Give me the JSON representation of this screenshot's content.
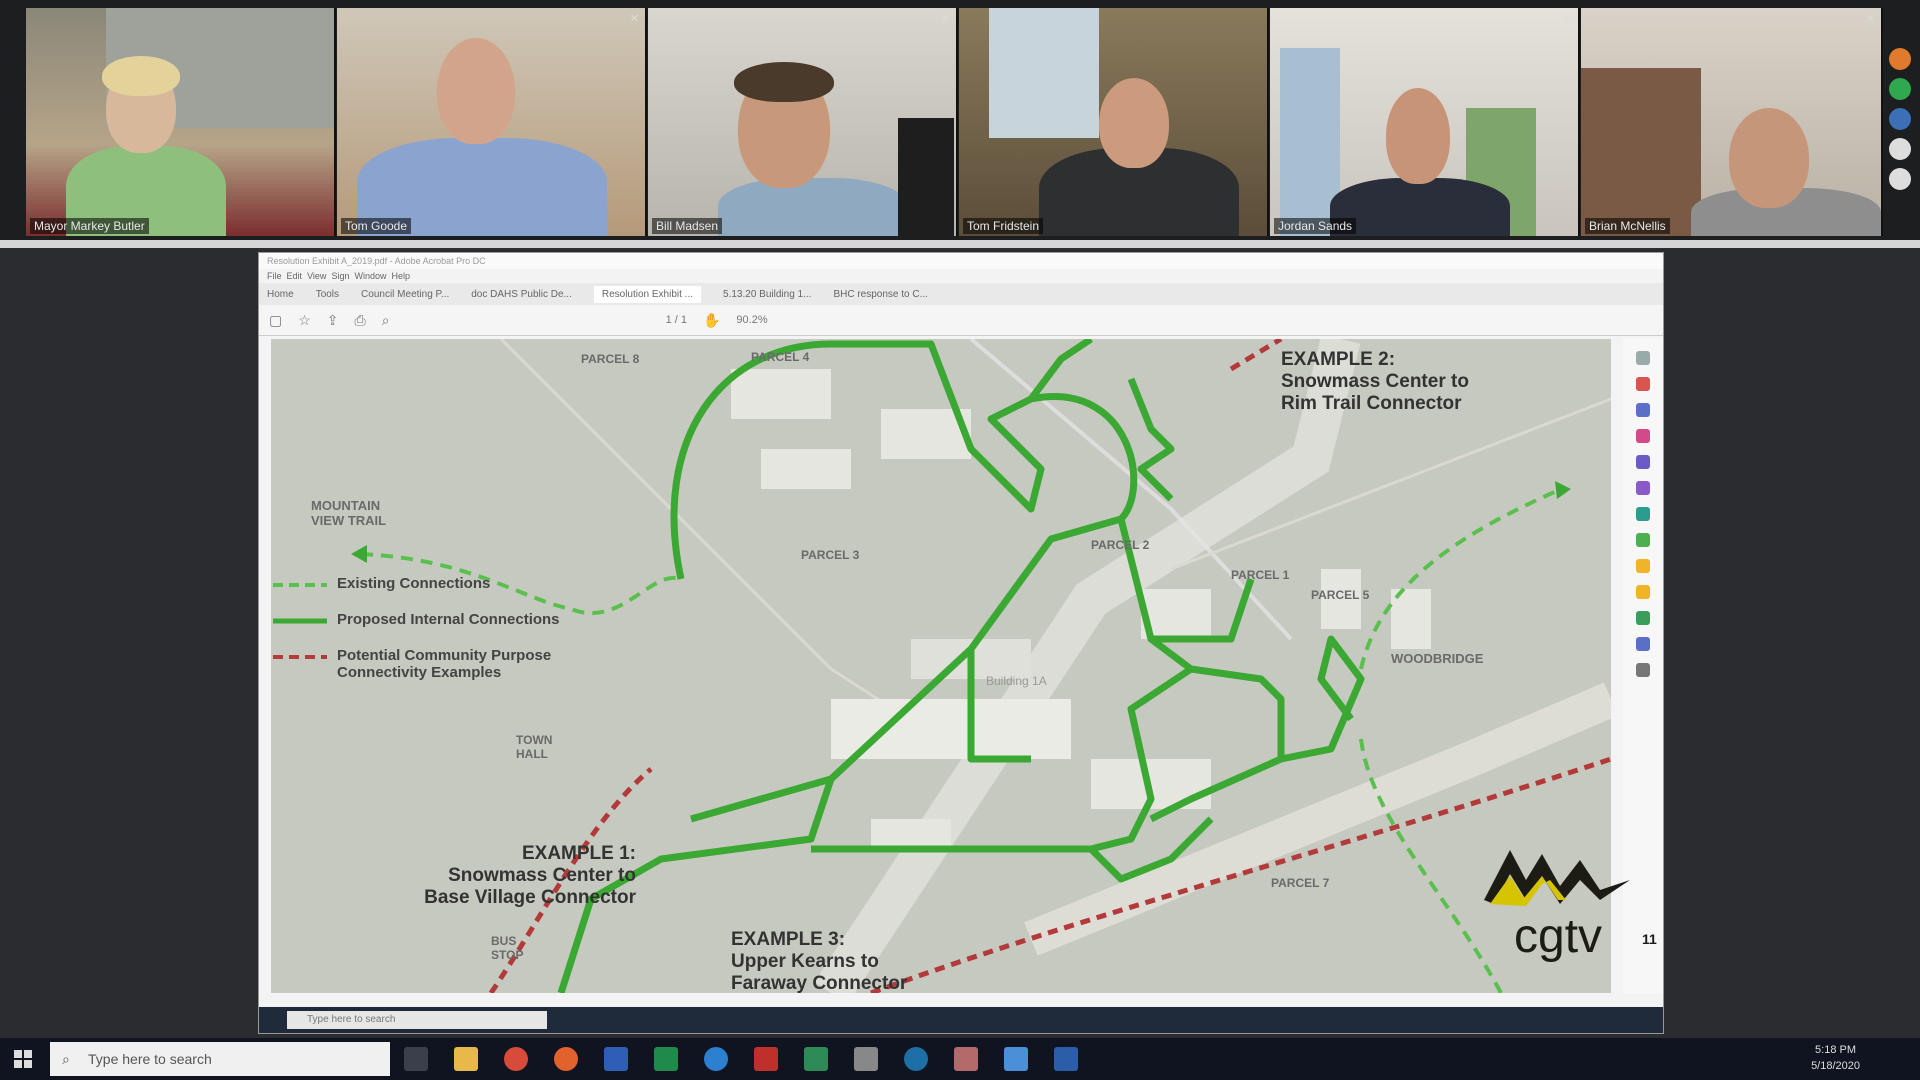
{
  "participants": [
    {
      "name": "Mayor Markey Butler"
    },
    {
      "name": "Tom Goode"
    },
    {
      "name": "Bill Madsen"
    },
    {
      "name": "Tom Fridstein"
    },
    {
      "name": "Jordan Sands"
    },
    {
      "name": "Brian McNellis"
    }
  ],
  "screen_share": {
    "window_title": "Resolution Exhibit A_2019.pdf - Adobe Acrobat Pro DC",
    "menu": [
      "File",
      "Edit",
      "View",
      "Sign",
      "Window",
      "Help"
    ],
    "tabs": [
      "Home",
      "Tools",
      "Council Meeting P...",
      "doc DAHS Public De...",
      "Resolution Exhibit ...",
      "5.13.20 Building 1...",
      "BHC response to C..."
    ],
    "page_indicator": "1 / 1",
    "zoom": "90.2%"
  },
  "map": {
    "example_2": {
      "line1": "EXAMPLE 2:",
      "line2": "Snowmass Center to",
      "line3": "Rim Trail Connector"
    },
    "example_1": {
      "line1": "EXAMPLE 1:",
      "line2": "Snowmass Center to",
      "line3": "Base Village Connector"
    },
    "example_3": {
      "line1": "EXAMPLE 3:",
      "line2": "Upper Kearns to",
      "line3": "Faraway Connector"
    },
    "mountain_view": {
      "line1": "MOUNTAIN",
      "line2": "VIEW TRAIL"
    },
    "town_hall": {
      "line1": "TOWN",
      "line2": "HALL"
    },
    "bus_stop": {
      "line1": "BUS",
      "line2": "STOP"
    },
    "woodbridge": "WOODBRIDGE",
    "parcels": [
      "PARCEL 8",
      "PARCEL 4",
      "PARCEL 3",
      "PARCEL 2",
      "PARCEL 1",
      "PARCEL 5",
      "PARCEL 7"
    ],
    "building_1a": "Building 1A",
    "legend": {
      "existing": "Existing Connections",
      "proposed": "Proposed Internal Connections",
      "potential_1": "Potential Community Purpose",
      "potential_2": "Connectivity Examples"
    },
    "colors": {
      "green": "#3aa832",
      "red_dashed": "#b33a3a",
      "existing_green": "#5bbf4f"
    }
  },
  "logo": {
    "text": "cgtv",
    "number": "11"
  },
  "taskbar": {
    "search_placeholder": "Type here to search",
    "time": "5:18 PM",
    "date": "5/18/2020"
  }
}
